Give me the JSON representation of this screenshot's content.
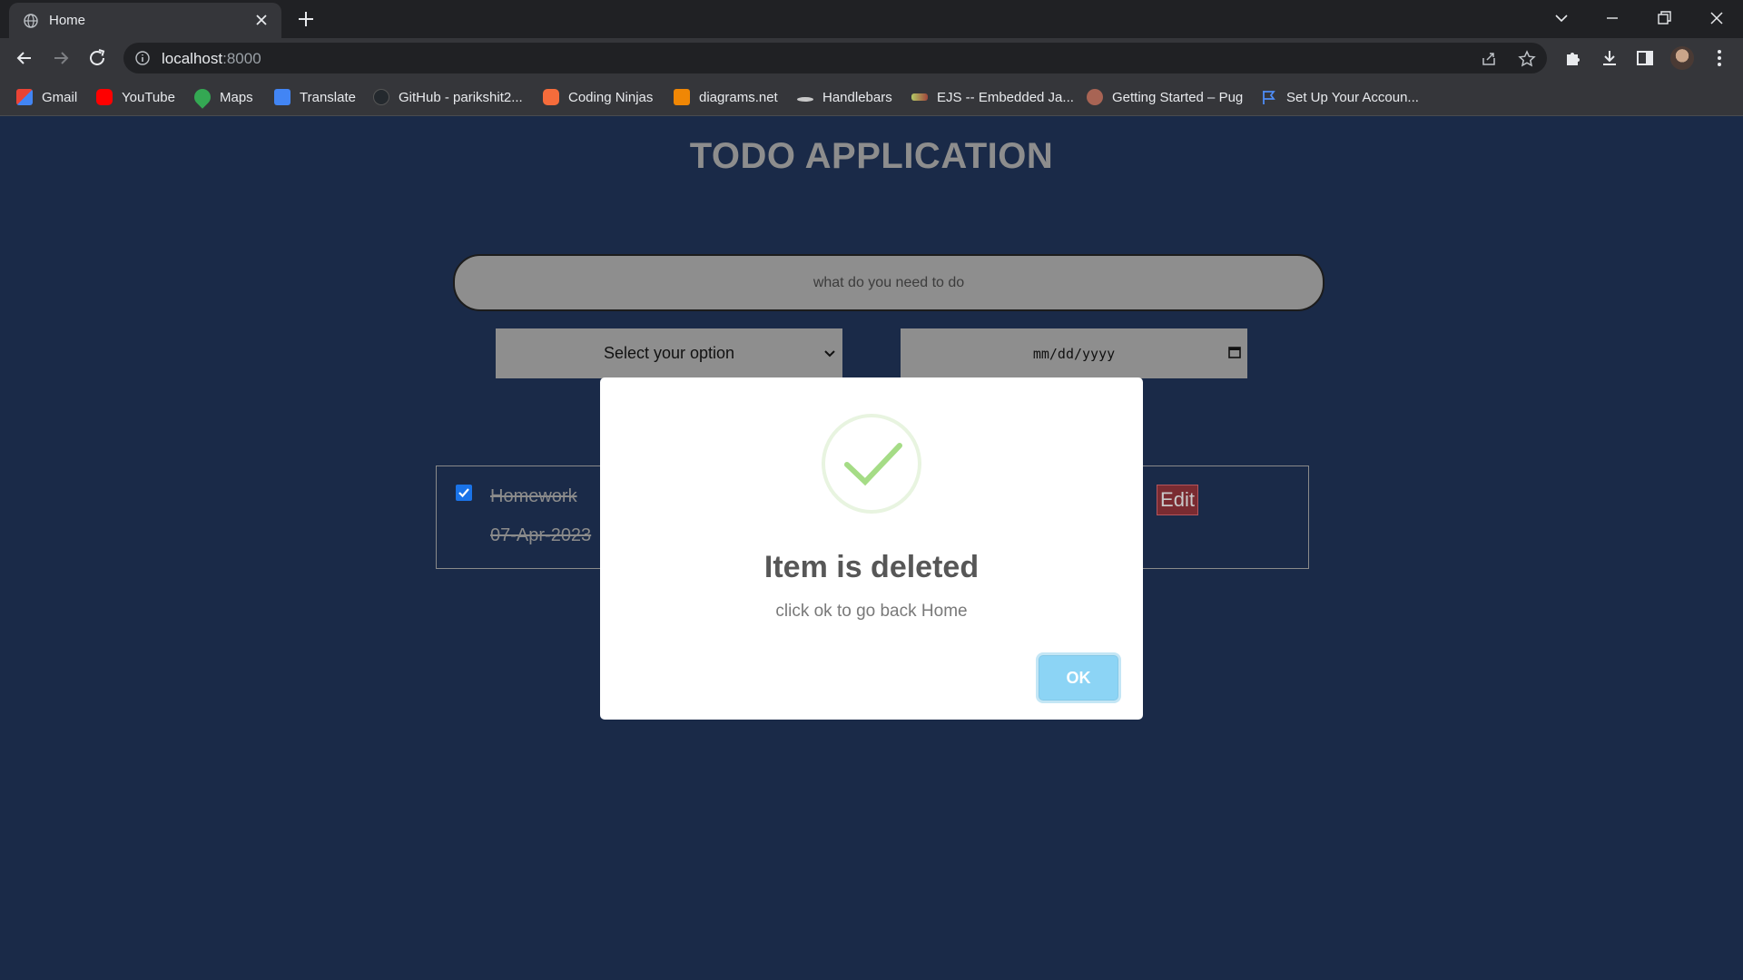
{
  "browser": {
    "tab_title": "Home",
    "url_host": "localhost",
    "url_port": ":8000",
    "bookmarks": [
      {
        "label": "Gmail",
        "icon": "gmail-icon",
        "color": "#ea4335"
      },
      {
        "label": "YouTube",
        "icon": "youtube-icon",
        "color": "#ff0000"
      },
      {
        "label": "Maps",
        "icon": "maps-icon",
        "color": "#34a853"
      },
      {
        "label": "Translate",
        "icon": "translate-icon",
        "color": "#4285f4"
      },
      {
        "label": "GitHub - parikshit2...",
        "icon": "github-icon",
        "color": "#24292e"
      },
      {
        "label": "Coding Ninjas",
        "icon": "coding-ninjas-icon",
        "color": "#f66c3b"
      },
      {
        "label": "diagrams.net",
        "icon": "diagrams-icon",
        "color": "#f08705"
      },
      {
        "label": "Handlebars",
        "icon": "handlebars-icon",
        "color": "#c8c8c8"
      },
      {
        "label": "EJS -- Embedded Ja...",
        "icon": "ejs-icon",
        "color": "#b4ca65"
      },
      {
        "label": "Getting Started – Pug",
        "icon": "pug-icon",
        "color": "#a86454"
      },
      {
        "label": "Set Up Your Accoun...",
        "icon": "flag-icon",
        "color": "#4e8cf6"
      }
    ]
  },
  "app": {
    "title": "TODO APPLICATION",
    "input_placeholder": "what do you need to do",
    "category_select": "Select your option",
    "date_placeholder": "mm/dd/yyyy"
  },
  "task": {
    "name": "Homework",
    "date": "07-Apr-2023",
    "checked": true,
    "edit_label": "Edit"
  },
  "modal": {
    "title": "Item is deleted",
    "text": "click ok to go back Home",
    "ok_label": "OK"
  },
  "colors": {
    "page_bg": "#1a2a48",
    "success": "#a5dc86",
    "ok_button": "#8cd4f5",
    "edit_button": "#7a2b31"
  }
}
